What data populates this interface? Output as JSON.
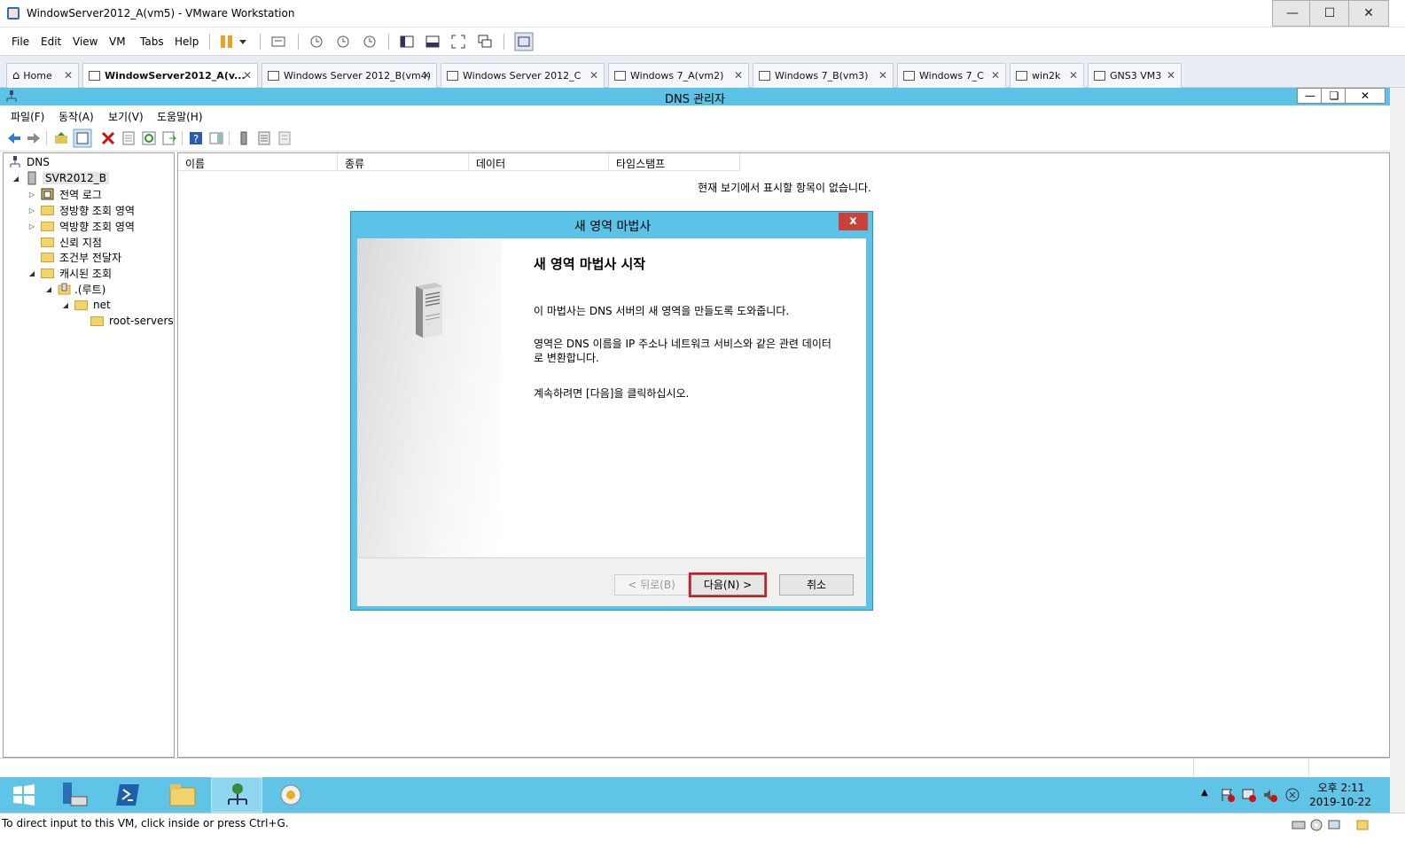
{
  "vmware": {
    "window_title": "WindowServer2012_A(vm5) - VMware Workstation",
    "menu": [
      "File",
      "Edit",
      "View",
      "VM",
      "Tabs",
      "Help"
    ],
    "tabs": [
      {
        "label": "Home",
        "active": false
      },
      {
        "label": "WindowServer2012_A(v...",
        "active": true
      },
      {
        "label": "Windows Server 2012_B(vm4)",
        "active": false
      },
      {
        "label": "Windows Server 2012_C",
        "active": false
      },
      {
        "label": "Windows 7_A(vm2)",
        "active": false
      },
      {
        "label": "Windows 7_B(vm3)",
        "active": false
      },
      {
        "label": "Windows 7_C",
        "active": false
      },
      {
        "label": "win2k",
        "active": false
      },
      {
        "label": "GNS3 VM3",
        "active": false
      }
    ],
    "status_message": "To direct input to this VM, click inside or press Ctrl+G."
  },
  "dns_manager": {
    "title": "DNS 관리자",
    "menu": [
      "파일(F)",
      "동작(A)",
      "보기(V)",
      "도움말(H)"
    ],
    "tree": {
      "root": "DNS",
      "server": "SVR2012_B",
      "items": [
        "전역 로그",
        "정방향 조회 영역",
        "역방향 조회 영역",
        "신뢰 지점",
        "조건부 전달자",
        "캐시된 조회"
      ],
      "cached": {
        "root_label": ".(루트)",
        "net": "net",
        "root_servers": "root-servers"
      }
    },
    "columns": [
      "이름",
      "종류",
      "데이터",
      "타임스탬프"
    ],
    "empty_message": "현재 보기에서 표시할 항목이 없습니다."
  },
  "wizard": {
    "title": "새 영역 마법사",
    "heading": "새 영역 마법사 시작",
    "para1": "이 마법사는 DNS 서버의 새 영역을 만들도록 도와줍니다.",
    "para2": "영역은 DNS 이름을 IP 주소나 네트워크 서비스와 같은 관련 데이터로 변환합니다.",
    "para3": "계속하려면 [다음]을 클릭하십시오.",
    "back_label": "< 뒤로(B)",
    "next_label": "다음(N) >",
    "cancel_label": "취소",
    "close_label": "x"
  },
  "taskbar": {
    "time": "오후 2:11",
    "date": "2019-10-22"
  },
  "colors": {
    "taskbar": "#5fc4e6",
    "accent": "#5bc3e7",
    "highlight": "#e0141c"
  }
}
